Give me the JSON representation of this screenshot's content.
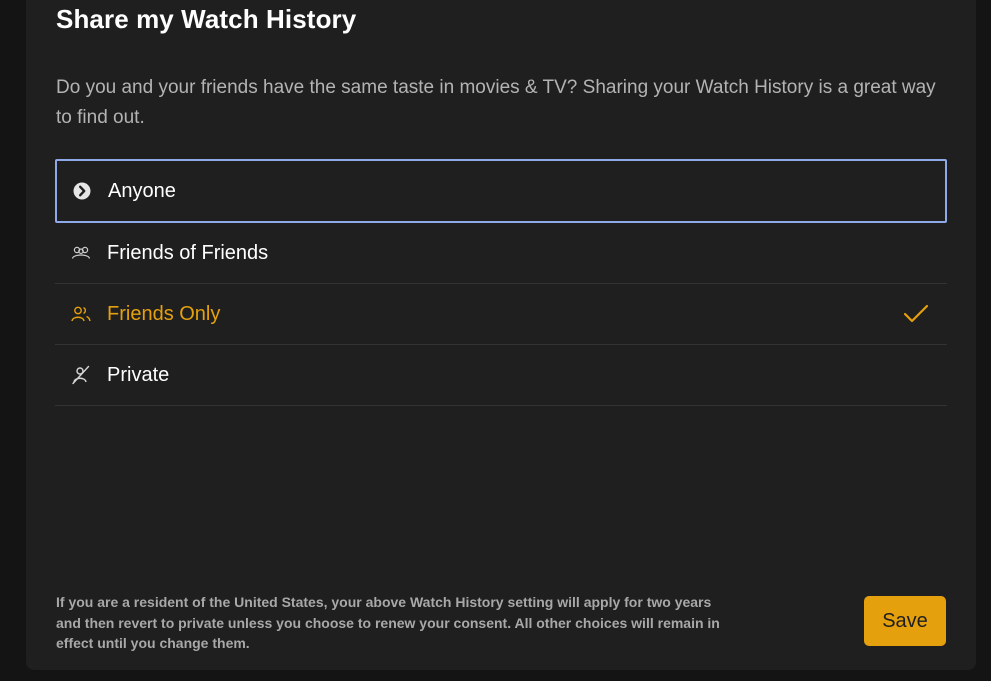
{
  "dialog": {
    "title": "Share my Watch History",
    "description": "Do you and your friends have the same taste in movies & TV? Sharing your Watch History is a great way to find out.",
    "footnote": "If you are a resident of the United States, your above Watch History setting will apply for two years and then revert to private unless you choose to renew your consent. All other choices will remain in effect until you change them.",
    "save_label": "Save"
  },
  "options": [
    {
      "label": "Anyone",
      "icon": "chevron-right-circle-icon",
      "focused": true,
      "selected": false
    },
    {
      "label": "Friends of Friends",
      "icon": "group-icon",
      "focused": false,
      "selected": false
    },
    {
      "label": "Friends Only",
      "icon": "friends-icon",
      "focused": false,
      "selected": true
    },
    {
      "label": "Private",
      "icon": "private-icon",
      "focused": false,
      "selected": false
    }
  ],
  "colors": {
    "accent": "#e5a00d",
    "focus_ring": "#8fa8e8",
    "modal_bg": "#1f1f1f",
    "text_primary": "#ffffff",
    "text_secondary": "#b3b3b3"
  }
}
